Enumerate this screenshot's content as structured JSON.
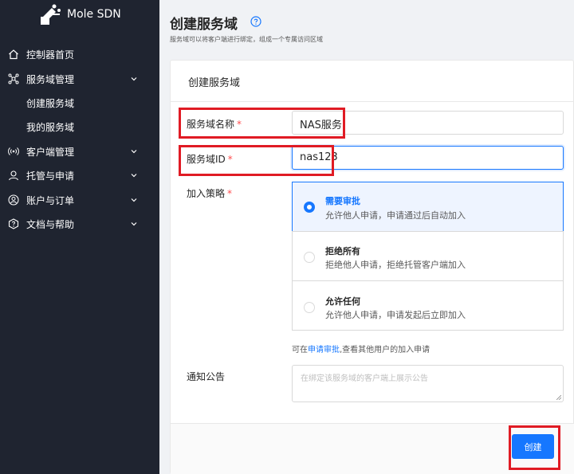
{
  "brand": {
    "name": "Mole SDN"
  },
  "sidebar": {
    "items": [
      {
        "label": "控制器首页",
        "icon": "home-icon"
      },
      {
        "label": "服务域管理",
        "icon": "network-icon",
        "expanded": true
      },
      {
        "label": "客户端管理",
        "icon": "broadcast-icon"
      },
      {
        "label": "托管与申请",
        "icon": "users-icon"
      },
      {
        "label": "账户与订单",
        "icon": "user-circle-icon"
      },
      {
        "label": "文档与帮助",
        "icon": "question-shield-icon"
      }
    ],
    "sub_items": [
      {
        "label": "创建服务域"
      },
      {
        "label": "我的服务域"
      }
    ]
  },
  "page": {
    "title": "创建服务域",
    "description": "服务域可以将客户端进行绑定，组成一个专属访问区域"
  },
  "card": {
    "title": "创建服务域"
  },
  "form": {
    "name_label": "服务域名称",
    "name_value": "NAS服务",
    "id_label": "服务域ID",
    "id_value": "nas123",
    "policy_label": "加入策略",
    "required_mark": "*",
    "options": [
      {
        "title": "需要审批",
        "desc": "允许他人申请，申请通过后自动加入",
        "selected": true
      },
      {
        "title": "拒绝所有",
        "desc": "拒绝他人申请，拒绝托管客户端加入",
        "selected": false
      },
      {
        "title": "允许任何",
        "desc": "允许他人申请，申请发起后立即加入",
        "selected": false
      }
    ],
    "hint_prefix": "可在",
    "hint_link": "申请审批",
    "hint_suffix": ",查看其他用户的加入申请",
    "notice_label": "通知公告",
    "notice_placeholder": "在绑定该服务域的客户端上展示公告"
  },
  "footer": {
    "create_label": "创建"
  },
  "colors": {
    "primary": "#1677ff",
    "sidebar_bg": "#1f2430",
    "highlight": "#e01b24",
    "required": "#ff4d4f"
  }
}
